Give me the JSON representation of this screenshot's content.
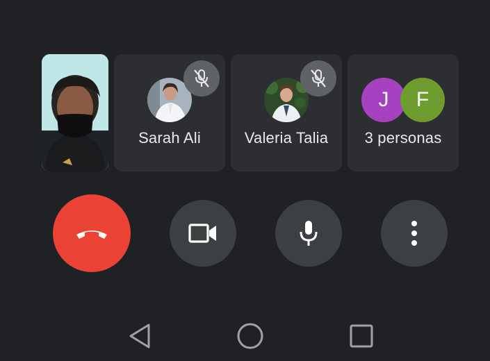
{
  "participants": [
    {
      "name": "Sarah Ali",
      "muted": true,
      "avatar": "photo"
    },
    {
      "name": "Valeria Talia",
      "muted": true,
      "avatar": "photo"
    },
    {
      "name": "3 personas",
      "letters": [
        "J",
        "F"
      ],
      "colors": [
        "#a642c2",
        "#6d9c2f"
      ]
    }
  ],
  "controls": {
    "end_call": "call-end-icon",
    "camera": "videocam-icon",
    "microphone": "mic-icon",
    "more": "more-vert-icon",
    "end_call_color": "#ea4335"
  },
  "nav": [
    "back-icon",
    "home-icon",
    "recents-icon"
  ]
}
